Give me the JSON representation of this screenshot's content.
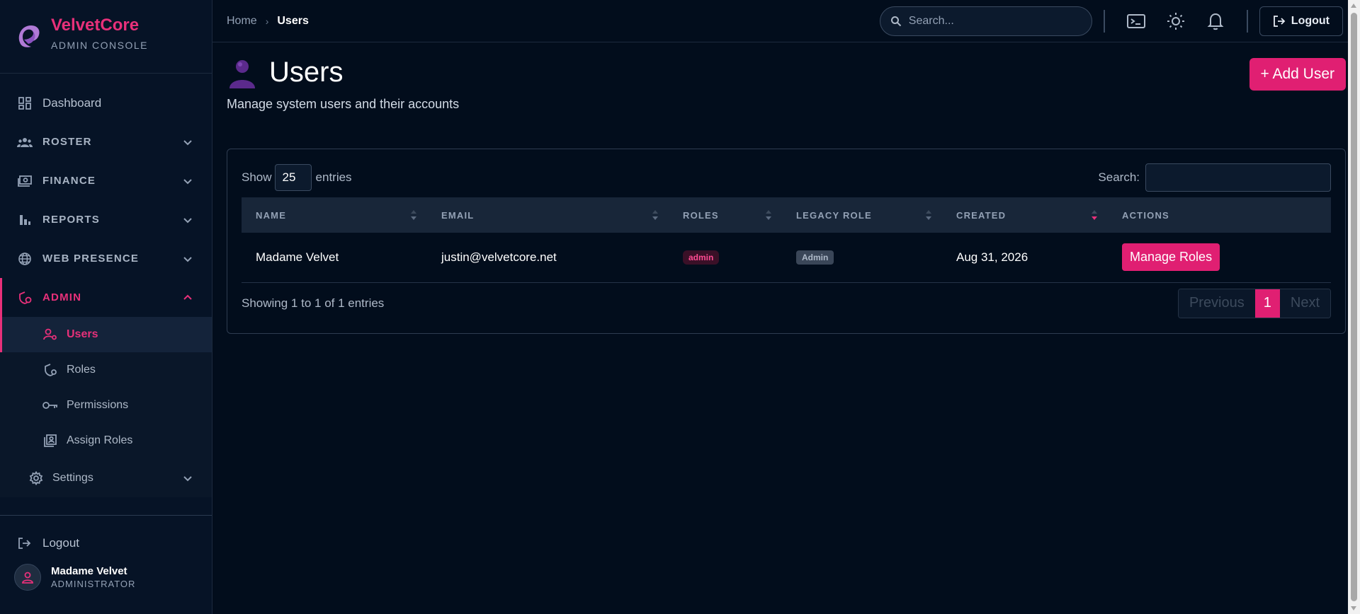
{
  "brand": {
    "name": "VelvetCore",
    "subtitle": "ADMIN CONSOLE"
  },
  "sidebar": {
    "dashboard": "Dashboard",
    "roster": "ROSTER",
    "finance": "FINANCE",
    "reports": "REPORTS",
    "web_presence": "WEB PRESENCE",
    "admin": "ADMIN",
    "admin_items": [
      "Users",
      "Roles",
      "Permissions",
      "Assign Roles"
    ],
    "settings": "Settings",
    "logout": "Logout"
  },
  "user": {
    "name": "Madame Velvet",
    "role": "ADMINISTRATOR"
  },
  "breadcrumb": {
    "home": "Home",
    "current": "Users"
  },
  "topbar": {
    "search_placeholder": "Search...",
    "logout": "Logout"
  },
  "page": {
    "title": "Users",
    "description": "Manage system users and their accounts",
    "add_button": "+ Add User"
  },
  "table_controls": {
    "show": "Show",
    "entries_value": "25",
    "entries": "entries",
    "search_label": "Search:"
  },
  "table": {
    "headers": [
      "NAME",
      "EMAIL",
      "ROLES",
      "LEGACY ROLE",
      "CREATED",
      "ACTIONS"
    ],
    "rows": [
      {
        "name": "Madame Velvet",
        "email": "justin@velvetcore.net",
        "role": "admin",
        "legacy_role": "Admin",
        "created": "Aug 31, 2026",
        "action": "Manage Roles"
      }
    ]
  },
  "footer": {
    "info": "Showing 1 to 1 of 1 entries",
    "previous": "Previous",
    "page": "1",
    "next": "Next"
  },
  "colors": {
    "accent": "#e01f72",
    "background": "#020d1c",
    "sidebar": "#061326"
  }
}
